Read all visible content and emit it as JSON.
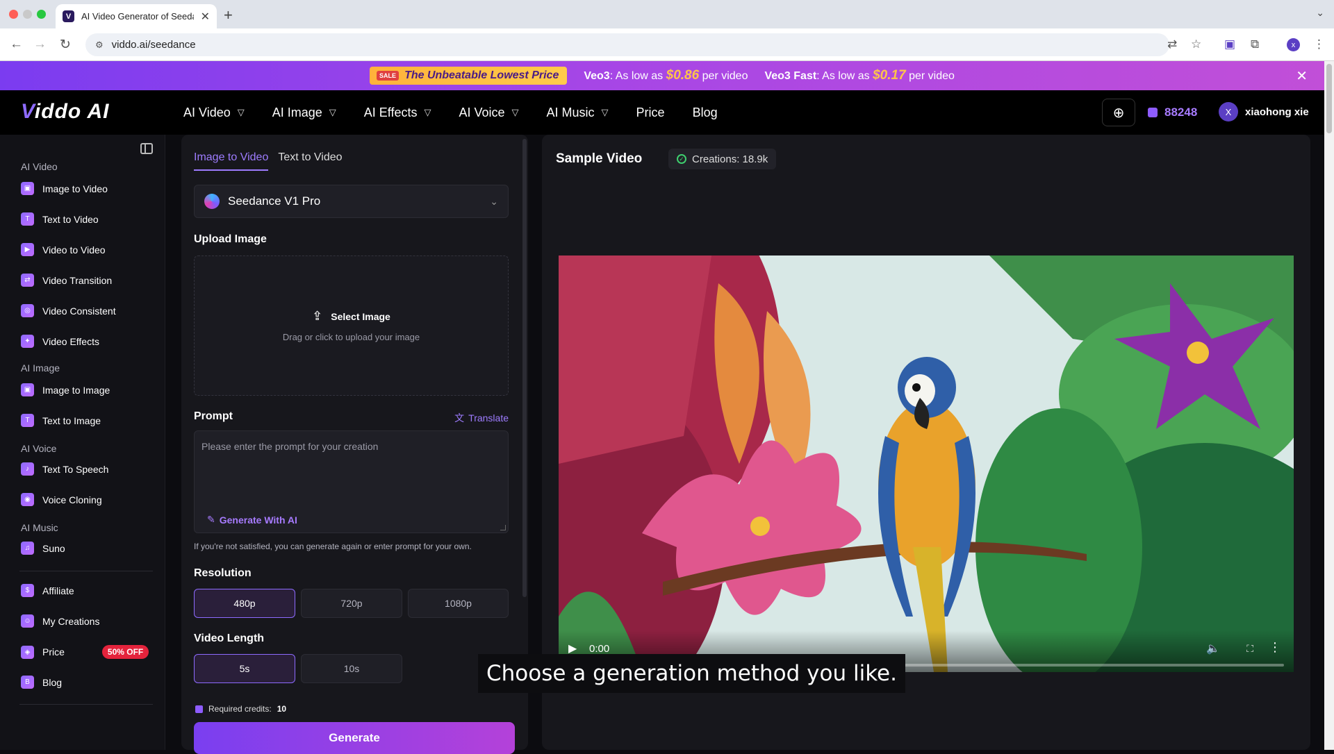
{
  "browser": {
    "tab_title": "AI Video Generator of Seedance",
    "url": "viddo.ai/seedance",
    "profile_initial": "x"
  },
  "promo": {
    "pill": "The Unbeatable Lowest Price",
    "tag_icon": "SALE",
    "veo3_label": "Veo3",
    "veo3_text": ": As low as",
    "veo3_price": "$0.86",
    "veo3_suffix": "per video",
    "veo3fast_label": "Veo3 Fast",
    "veo3fast_text": ": As low as",
    "veo3fast_price": "$0.17",
    "veo3fast_suffix": "per video"
  },
  "nav": {
    "logo_v": "V",
    "logo_rest": "iddo AI",
    "items": [
      "AI Video",
      "AI Image",
      "AI Effects",
      "AI Voice",
      "AI Music",
      "Price",
      "Blog"
    ],
    "credits": "88248",
    "user_initial": "X",
    "user_name": "xiaohong xie"
  },
  "sidebar": {
    "groups": [
      "AI Video",
      "AI Image",
      "AI Voice",
      "AI Music"
    ],
    "video_items": [
      "Image to Video",
      "Text to Video",
      "Video to Video",
      "Video Transition",
      "Video Consistent",
      "Video Effects"
    ],
    "image_items": [
      "Image to Image",
      "Text to Image"
    ],
    "voice_items": [
      "Text To Speech",
      "Voice Cloning"
    ],
    "music_items": [
      "Suno"
    ],
    "bottom_items": [
      "Affiliate",
      "My Creations",
      "Price",
      "Blog"
    ],
    "price_badge": "50% OFF"
  },
  "form": {
    "tabs": [
      "Image to Video",
      "Text to Video"
    ],
    "model": "Seedance V1 Pro",
    "upload_label": "Upload Image",
    "select_image": "Select Image",
    "upload_hint": "Drag or click to upload your image",
    "prompt_label": "Prompt",
    "translate": "Translate",
    "prompt_placeholder": "Please enter the prompt for your creation",
    "generate_with_ai": "Generate With AI",
    "note": "If you're not satisfied, you can generate again or enter prompt for your own.",
    "resolution_label": "Resolution",
    "resolutions": [
      "480p",
      "720p",
      "1080p"
    ],
    "length_label": "Video Length",
    "lengths": [
      "5s",
      "10s"
    ],
    "required_credits_label": "Required credits:",
    "required_credits": "10",
    "generate": "Generate"
  },
  "preview": {
    "title": "Sample Video",
    "creations": "Creations: 18.9k",
    "time": "0:00"
  },
  "caption": "Choose a generation method you like.",
  "colors": {
    "accent": "#8e6bff",
    "promo_price": "#ffc44a",
    "badge_red": "#e4233c"
  }
}
